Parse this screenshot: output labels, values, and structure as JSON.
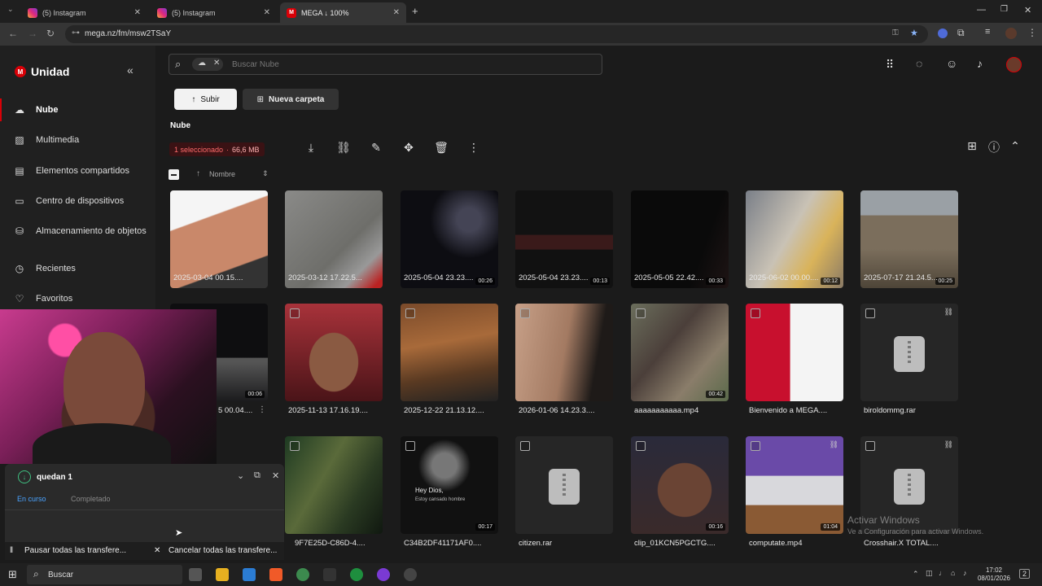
{
  "browser": {
    "tabs": [
      {
        "label": "(5) Instagram",
        "favicon": "instagram-icon"
      },
      {
        "label": "(5) Instagram",
        "favicon": "instagram-icon"
      },
      {
        "label": "MEGA ↓ 100%",
        "favicon": "mega-icon"
      }
    ],
    "url": "mega.nz/fm/msw2TSaY"
  },
  "sidebar": {
    "title": "Unidad",
    "items": [
      {
        "label": "Nube",
        "icon": "cloud-icon"
      },
      {
        "label": "Multimedia",
        "icon": "image-icon"
      },
      {
        "label": "Elementos compartidos",
        "icon": "folder-shared-icon"
      },
      {
        "label": "Centro de dispositivos",
        "icon": "devices-icon"
      },
      {
        "label": "Almacenamiento de objetos",
        "icon": "bucket-icon"
      },
      {
        "label": "Recientes",
        "icon": "clock-icon"
      },
      {
        "label": "Favoritos",
        "icon": "heart-icon"
      }
    ]
  },
  "header": {
    "search_placeholder": "Buscar Nube",
    "upload_label": "Subir",
    "new_folder_label": "Nueva carpeta",
    "breadcrumb": "Nube",
    "selection": "1 seleccionado",
    "selection_size": "66,6 MB",
    "sort_label": "Nombre"
  },
  "files": [
    {
      "name": "2025-03-04 00.15....",
      "duration": ""
    },
    {
      "name": "2025-03-12 17.22.5...",
      "duration": ""
    },
    {
      "name": "2025-05-04 23.23....",
      "duration": "00:26"
    },
    {
      "name": "2025-05-04 23.23....",
      "duration": "00:13"
    },
    {
      "name": "2025-05-05 22.42....",
      "duration": "00:33"
    },
    {
      "name": "2025-06-02 00.00....",
      "duration": "00:12"
    },
    {
      "name": "2025-07-17 21.24.5...",
      "duration": "00:25"
    },
    {
      "name": "5 00.04....",
      "duration": "00:06"
    },
    {
      "name": "2025-11-13 17.16.19....",
      "duration": ""
    },
    {
      "name": "2025-12-22 21.13.12....",
      "duration": ""
    },
    {
      "name": "2026-01-06 14.23.3....",
      "duration": ""
    },
    {
      "name": "aaaaaaaaaaa.mp4",
      "duration": "00:42"
    },
    {
      "name": "Bienvenido a MEGA....",
      "duration": ""
    },
    {
      "name": "biroldommg.rar",
      "duration": ""
    },
    {
      "name": "9F7E25D-C86D-4....",
      "duration": ""
    },
    {
      "name": "C34B2DF41171AF0....",
      "duration": "00:17"
    },
    {
      "name": "citizen.rar",
      "duration": ""
    },
    {
      "name": "clip_01KCN5PGCTG....",
      "duration": "00:16"
    },
    {
      "name": "computate.mp4",
      "duration": "01:04"
    },
    {
      "name": "Crosshair.X TOTAL....",
      "duration": ""
    }
  ],
  "thumb_overlay_text": [
    "Hey Dios,",
    "Estoy cansado hombre"
  ],
  "transfer": {
    "title": "quedan 1",
    "tab_active": "En curso",
    "tab_done": "Completado",
    "pause_label": "Pausar todas las transfere...",
    "cancel_label": "Cancelar todas las transfere..."
  },
  "watermark": {
    "line1": "Activar Windows",
    "line2": "Ve a Configuración para activar Windows."
  },
  "taskbar": {
    "search_label": "Buscar",
    "time": "17:02",
    "date": "08/01/2026",
    "notifications": "2"
  },
  "colors": {
    "accent": "#d90007",
    "success": "#3fbf80"
  }
}
